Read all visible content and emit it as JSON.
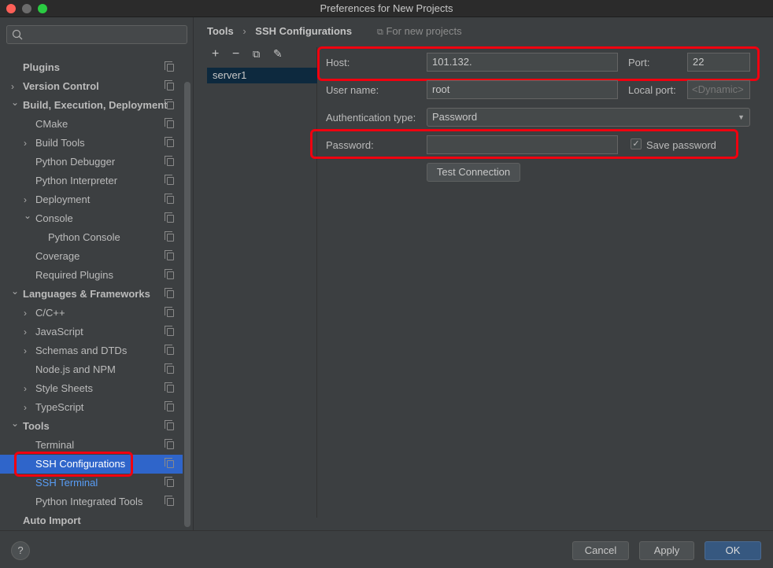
{
  "window": {
    "title": "Preferences for New Projects"
  },
  "sidebar": {
    "items": [
      {
        "label": "Plugins",
        "level": 0,
        "arrow": false
      },
      {
        "label": "Version Control",
        "level": 0,
        "arrow": true
      },
      {
        "label": "Build, Execution, Deployment",
        "level": 0,
        "arrow": true,
        "open": true
      },
      {
        "label": "CMake",
        "level": 1,
        "arrow": false
      },
      {
        "label": "Build Tools",
        "level": 1,
        "arrow": true
      },
      {
        "label": "Python Debugger",
        "level": 1,
        "arrow": false
      },
      {
        "label": "Python Interpreter",
        "level": 1,
        "arrow": false
      },
      {
        "label": "Deployment",
        "level": 1,
        "arrow": true
      },
      {
        "label": "Console",
        "level": 1,
        "arrow": true,
        "open": true
      },
      {
        "label": "Python Console",
        "level": 2,
        "arrow": false
      },
      {
        "label": "Coverage",
        "level": 1,
        "arrow": false
      },
      {
        "label": "Required Plugins",
        "level": 1,
        "arrow": false
      },
      {
        "label": "Languages & Frameworks",
        "level": 0,
        "arrow": true,
        "open": true
      },
      {
        "label": "C/C++",
        "level": 1,
        "arrow": true
      },
      {
        "label": "JavaScript",
        "level": 1,
        "arrow": true
      },
      {
        "label": "Schemas and DTDs",
        "level": 1,
        "arrow": true
      },
      {
        "label": "Node.js and NPM",
        "level": 1,
        "arrow": false
      },
      {
        "label": "Style Sheets",
        "level": 1,
        "arrow": true
      },
      {
        "label": "TypeScript",
        "level": 1,
        "arrow": true
      },
      {
        "label": "Tools",
        "level": 0,
        "arrow": true,
        "open": true
      },
      {
        "label": "Terminal",
        "level": 1,
        "arrow": false
      },
      {
        "label": "SSH Configurations",
        "level": 1,
        "arrow": false,
        "selected": true
      },
      {
        "label": "SSH Terminal",
        "level": 1,
        "arrow": false,
        "link": true
      },
      {
        "label": "Python Integrated Tools",
        "level": 1,
        "arrow": false
      },
      {
        "label": "Auto Import",
        "level": 0,
        "arrow": false,
        "nocopy": true
      }
    ]
  },
  "breadcrumb": {
    "parent": "Tools",
    "sep": "›",
    "current": "SSH Configurations",
    "scope": "For new projects"
  },
  "list": {
    "items": [
      "server1"
    ],
    "add": "+",
    "remove": "−"
  },
  "form": {
    "host_label": "Host:",
    "host_value": "101.132.",
    "port_label": "Port:",
    "port_value": "22",
    "user_label": "User name:",
    "user_value": "root",
    "local_port_label": "Local port:",
    "local_port_placeholder": "<Dynamic>",
    "auth_label": "Authentication type:",
    "auth_value": "Password",
    "password_label": "Password:",
    "password_value": "",
    "save_password_label": "Save password",
    "save_password_checked": true,
    "test_button": "Test Connection"
  },
  "footer": {
    "help": "?",
    "cancel": "Cancel",
    "apply": "Apply",
    "ok": "OK"
  },
  "colors": {
    "selection": "#2f65ca",
    "highlight": "#f0000f",
    "ok": "#365880",
    "link": "#589df6"
  }
}
